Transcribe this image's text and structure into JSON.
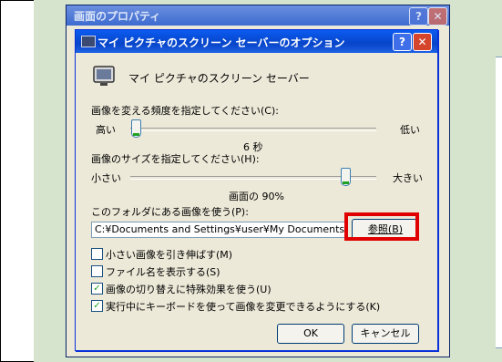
{
  "back_dialog": {
    "title": "画面のプロパティ",
    "help_glyph": "?",
    "close_glyph": "✕"
  },
  "dialog": {
    "title": "マイ ピクチャのスクリーン セーバーのオプション",
    "help_glyph": "?",
    "close_glyph": "✕",
    "screensaver_name": "マイ ピクチャのスクリーン セーバー",
    "frequency": {
      "label": "画像を変える頻度を指定してください(C):",
      "min_label": "高い",
      "max_label": "低い",
      "value_text": "6 秒",
      "slider_fraction": 0.02
    },
    "size": {
      "label": "画像のサイズを指定してください(H):",
      "min_label": "小さい",
      "max_label": "大きい",
      "value_text": "画面の 90%",
      "slider_fraction": 0.87
    },
    "folder": {
      "label": "このフォルダにある画像を使う(P):",
      "path": "C:¥Documents and Settings¥user¥My Documents¥My Pictures",
      "browse_label": "参照(B)"
    },
    "checkboxes": [
      {
        "label": "小さい画像を引き伸ばす(M)",
        "checked": false
      },
      {
        "label": "ファイル名を表示する(S)",
        "checked": false
      },
      {
        "label": "画像の切り替えに特殊効果を使う(U)",
        "checked": true
      },
      {
        "label": "実行中にキーボードを使って画像を変更できるようにする(K)",
        "checked": true
      }
    ],
    "ok_label": "OK",
    "cancel_label": "キャンセル"
  },
  "colors": {
    "highlight": "#e00000",
    "background": "#d6e3cd"
  }
}
